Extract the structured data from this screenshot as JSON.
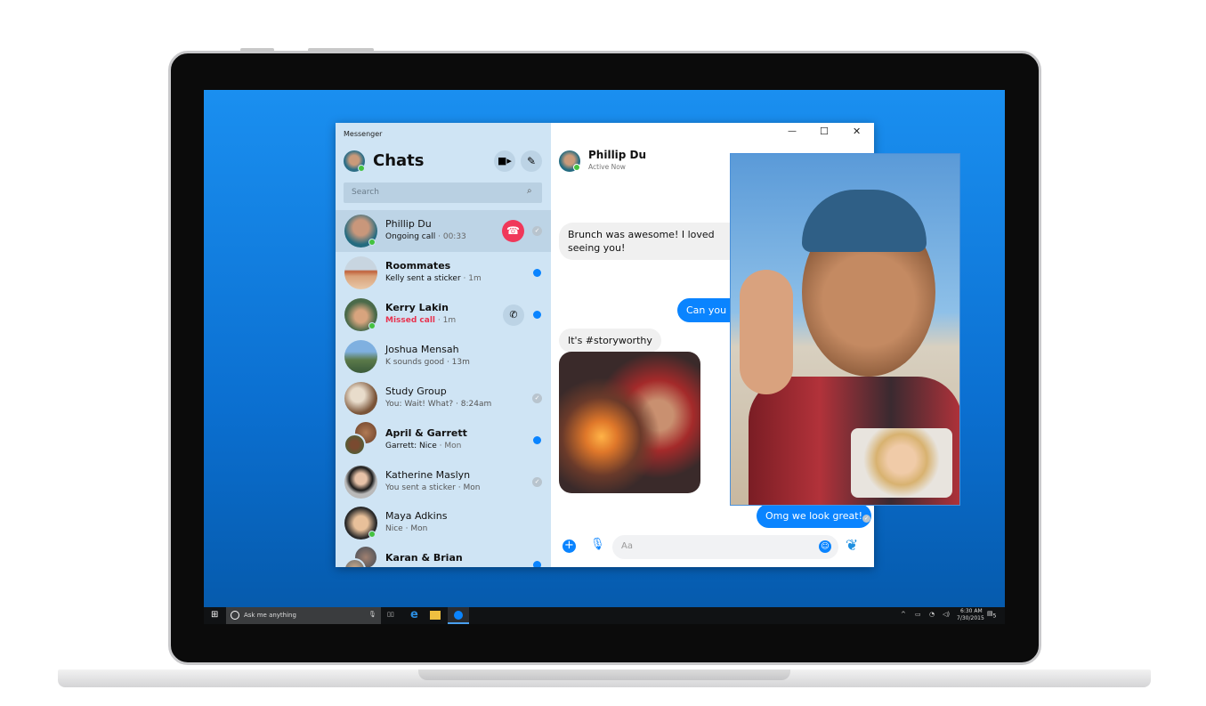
{
  "window": {
    "title": "Messenger",
    "controls": {
      "minimize": "—",
      "maximize": "☐",
      "close": "✕"
    }
  },
  "sidebar": {
    "heading": "Chats",
    "search_placeholder": "Search",
    "chats": [
      {
        "name": "Phillip Du",
        "preview": "Ongoing call",
        "time": "· 00:33",
        "online": true,
        "status": "read"
      },
      {
        "name": "Roommates",
        "preview": "Kelly sent a sticker",
        "time": "· 1m",
        "unread": true
      },
      {
        "name": "Kerry Lakin",
        "preview": "Missed call",
        "time": "· 1m",
        "online": true,
        "unread": true
      },
      {
        "name": "Joshua Mensah",
        "preview": "K sounds good",
        "time": "· 13m"
      },
      {
        "name": "Study Group",
        "preview": "You: Wait! What?",
        "time": "· 8:24am",
        "status": "read"
      },
      {
        "name": "April & Garrett",
        "preview": "Garrett: Nice",
        "time": "· Mon",
        "unread": true
      },
      {
        "name": "Katherine Maslyn",
        "preview": "You sent a sticker",
        "time": "· Mon",
        "status": "read"
      },
      {
        "name": "Maya Adkins",
        "preview": "Nice",
        "time": "· Mon",
        "online": true
      },
      {
        "name": "Karan & Brian",
        "preview": "",
        "time": "",
        "unread": true
      }
    ]
  },
  "conversation": {
    "contact": "Phillip Du",
    "status": "Active Now",
    "messages": [
      {
        "from": "them",
        "text": "Brunch was awesome! I loved seeing you!"
      },
      {
        "from": "me",
        "text": "Can you s"
      },
      {
        "from": "them",
        "text": "It's #storyworthy"
      },
      {
        "from": "me",
        "text": "Omg we look great!"
      }
    ],
    "composer_placeholder": "Aa"
  },
  "taskbar": {
    "search": "Ask me anything",
    "time": "6:30 AM",
    "date": "7/30/2015",
    "notifications": "5"
  },
  "colors": {
    "accent": "#0a84ff",
    "sidebar": "#cfe4f4",
    "missed": "#e8334f",
    "end_call": "#f0385a"
  }
}
